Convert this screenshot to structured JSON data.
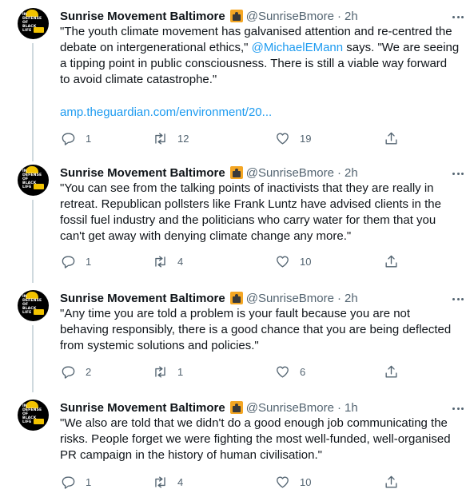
{
  "colors": {
    "link": "#1d9bf0",
    "muted": "#536471",
    "text": "#0f1419",
    "thread": "#cfd9de"
  },
  "avatar_text": "IN DEFENSE OF BLACK LIFE",
  "tweets": [
    {
      "name": "Sunrise Movement Baltimore",
      "handle": "@SunriseBmore",
      "separator": "·",
      "time": "2h",
      "text_before": "\"The youth climate movement has galvanised attention and re-centred the debate on intergenerational ethics,\" ",
      "mention": "@MichaelEMann",
      "text_after": " says. \"We are seeing a tipping point in public consciousness. There is still a viable way forward to avoid climate catastrophe.\"",
      "link": "amp.theguardian.com/environment/20...",
      "replies": "1",
      "retweets": "12",
      "likes": "19"
    },
    {
      "name": "Sunrise Movement Baltimore",
      "handle": "@SunriseBmore",
      "separator": "·",
      "time": "2h",
      "text": "\"You can see from the talking points of inactivists that they are really in retreat. Republican pollsters like Frank Luntz have advised clients in the fossil fuel industry and the politicians who carry water for them that you can't get away with denying climate change any more.\"",
      "replies": "1",
      "retweets": "4",
      "likes": "10"
    },
    {
      "name": "Sunrise Movement Baltimore",
      "handle": "@SunriseBmore",
      "separator": "·",
      "time": "2h",
      "text": "\"Any time you are told a problem is your fault because you are not behaving responsibly, there is a good chance that you are being deflected from systemic solutions and policies.\"",
      "replies": "2",
      "retweets": "1",
      "likes": "6"
    },
    {
      "name": "Sunrise Movement Baltimore",
      "handle": "@SunriseBmore",
      "separator": "·",
      "time": "1h",
      "text": "\"We also are told that we didn't do a good enough job communicating the risks. People forget we were fighting the most well-funded, well-organised PR campaign in the history of human civilisation.\"",
      "replies": "1",
      "retweets": "4",
      "likes": "10"
    }
  ]
}
